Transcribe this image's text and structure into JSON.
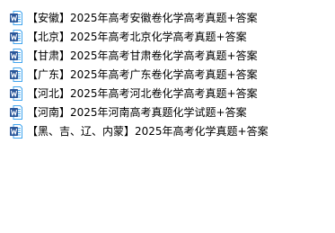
{
  "header_partial": "",
  "files": [
    {
      "name": "【安徽】2025年高考安徽卷化学高考真题+答案",
      "icon": "word-doc-icon"
    },
    {
      "name": "【北京】2025年高考北京化学高考真题+答案",
      "icon": "word-doc-icon"
    },
    {
      "name": "【甘肃】2025年高考甘肃卷化学高考真题+答案",
      "icon": "word-doc-icon"
    },
    {
      "name": "【广东】2025年高考广东卷化学高考真题+答案",
      "icon": "word-doc-icon"
    },
    {
      "name": "【河北】2025年高考河北卷化学高考真题+答案",
      "icon": "word-doc-icon"
    },
    {
      "name": "【河南】2025年河南高考真题化学试题+答案",
      "icon": "word-doc-icon"
    },
    {
      "name": "【黑、吉、辽、内蒙】2025年高考化学真题+答案",
      "icon": "word-doc-icon"
    }
  ],
  "colors": {
    "word_blue": "#2b579a",
    "word_blue_light": "#41a5ee",
    "text": "#000000",
    "background": "#ffffff"
  }
}
